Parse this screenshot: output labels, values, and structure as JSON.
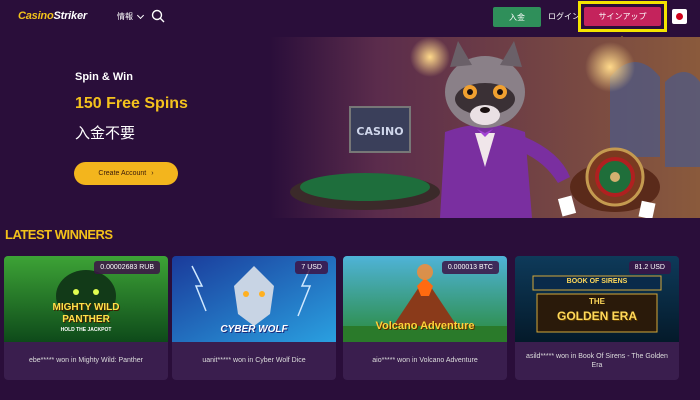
{
  "header": {
    "logo_part1": "Casino",
    "logo_part2": "Striker",
    "info_label": "情報",
    "deposit_label": "入金",
    "login_label": "ログイン",
    "signup_label": "サインアップ"
  },
  "hero": {
    "subtitle": "Spin & Win",
    "title": "150 Free Spins",
    "tagline": "入金不要",
    "cta_label": "Create Account",
    "sign_text": "CASINO"
  },
  "section": {
    "title": "LATEST WINNERS"
  },
  "winners": [
    {
      "amount": "0.00002683 RUB",
      "caption": "ebe***** won in Mighty Wild: Panther",
      "game_line1": "MIGHTY WILD",
      "game_line2": "PANTHER",
      "game_line3": "HOLD THE JACKPOT"
    },
    {
      "amount": "7 USD",
      "caption": "uanit***** won in Cyber Wolf Dice",
      "game_line1": "CYBER WOLF"
    },
    {
      "amount": "0.000013 BTC",
      "caption": "aio***** won in Volcano Adventure",
      "game_line1": "Volcano Adventure"
    },
    {
      "amount": "81.2 USD",
      "caption": "asild***** won in Book Of Sirens - The Golden Era",
      "game_line1": "BOOK OF SIRENS",
      "game_line2": "THE",
      "game_line3": "GOLDEN ERA"
    }
  ],
  "colors": {
    "background": "#2a0e3a",
    "accent_yellow": "#f3c11a",
    "deposit_green": "#2f8f5a",
    "signup_pink": "#c4235c",
    "highlight_yellow": "#f4e400"
  }
}
